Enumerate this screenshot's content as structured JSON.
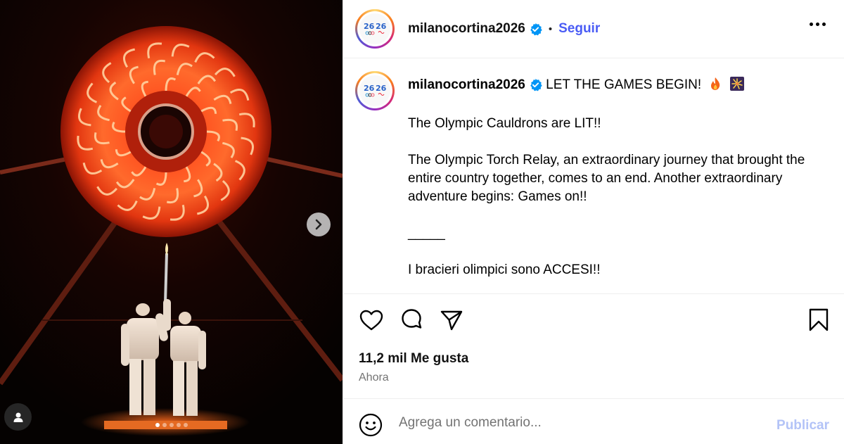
{
  "header": {
    "username": "milanocortina2026",
    "separator": "•",
    "follow_label": "Seguir",
    "more_icon": "more-horizontal-icon"
  },
  "caption": {
    "username": "milanocortina2026",
    "headline": "LET THE GAMES BEGIN!",
    "line1": "The Olympic Cauldrons are LIT!!",
    "line2": "The Olympic Torch Relay, an extraordinary journey that brought the entire country together, comes to an end. Another extraordinary adventure begins: Games on!!",
    "divider": "_____",
    "line3": "I bracieri olimpici sono ACCESI!!"
  },
  "actions": {
    "like_icon": "heart-icon",
    "comment_icon": "comment-icon",
    "share_icon": "send-icon",
    "save_icon": "bookmark-icon"
  },
  "likes_text": "11,2 mil Me gusta",
  "time_text": "Ahora",
  "comment": {
    "placeholder": "Agrega un comentario...",
    "publish_label": "Publicar"
  },
  "carousel": {
    "total": 5,
    "active": 1
  },
  "colors": {
    "follow": "#4a5cf5",
    "verified": "#0095f6",
    "publish_disabled": "#b3c3f7"
  }
}
